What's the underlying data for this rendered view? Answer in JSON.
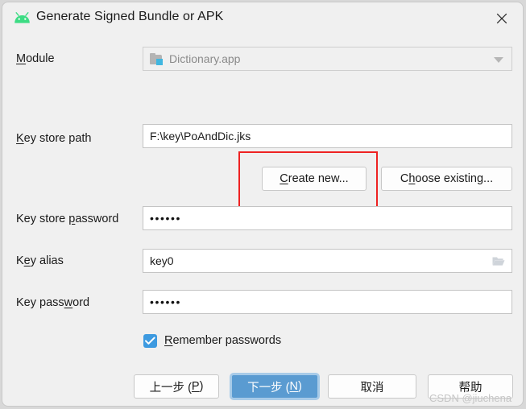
{
  "window": {
    "title": "Generate Signed Bundle or APK",
    "app_icon": "android-robot-icon",
    "close_icon": "close-icon"
  },
  "form": {
    "module": {
      "label_pre": "M",
      "label_post": "odule",
      "value": "Dictionary.app",
      "icon": "module-folder-icon",
      "dropdown_icon": "chevron-down-icon",
      "disabled": true
    },
    "key_store_path": {
      "label_pre": "K",
      "label_post": "ey store path",
      "value": "F:\\key\\PoAndDic.jks"
    },
    "key_store_password": {
      "label_a": "Key store ",
      "label_mn": "p",
      "label_b": "assword",
      "value": "••••••"
    },
    "key_alias": {
      "label_a": "K",
      "label_mn": "e",
      "label_b": "y alias",
      "value": "key0",
      "browse_icon": "folder-open-icon"
    },
    "key_password": {
      "label_a": "Key pass",
      "label_mn": "w",
      "label_b": "ord",
      "value": "••••••"
    },
    "remember_passwords": {
      "label_mn": "R",
      "label_post": "emember passwords",
      "checked": true,
      "check_icon": "checkmark-icon"
    }
  },
  "actions": {
    "create_new": {
      "mn": "C",
      "rest": "reate new..."
    },
    "choose_existing": {
      "pre": "C",
      "mn": "h",
      "rest": "oose existing..."
    }
  },
  "footer": {
    "previous": {
      "text": "上一步 (",
      "mn": "P",
      "close": ")"
    },
    "next": {
      "text": "下一步 (",
      "mn": "N",
      "close": ")"
    },
    "cancel": "取消",
    "help": "帮助"
  },
  "annotation": {
    "color": "#ee2222",
    "target": "create-new-button"
  },
  "watermark": "CSDN @jiuchena"
}
